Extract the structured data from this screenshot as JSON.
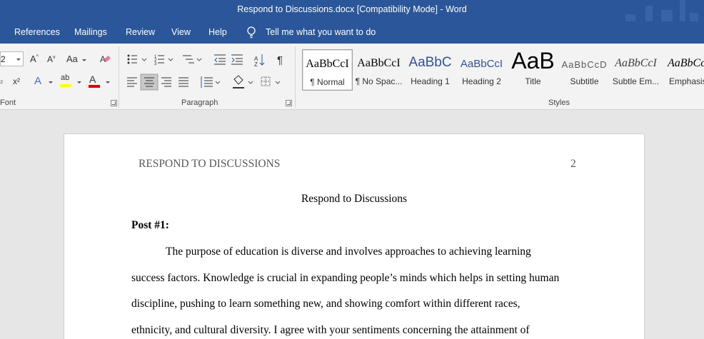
{
  "window": {
    "title": "Respond to Discussions.docx [Compatibility Mode]  -  Word"
  },
  "tabs": [
    {
      "label": "References"
    },
    {
      "label": "Mailings"
    },
    {
      "label": "Review"
    },
    {
      "label": "View"
    },
    {
      "label": "Help"
    }
  ],
  "tell_me": {
    "label": "Tell me what you want to do",
    "icon": "lightbulb-icon"
  },
  "ribbon": {
    "font_group": {
      "label": "Font",
      "font_size": "2",
      "icons": [
        "grow-font-icon",
        "shrink-font-icon",
        "change-case-icon",
        "clear-formatting-icon",
        "subscript-icon",
        "superscript-icon",
        "text-effects-icon",
        "highlight-icon",
        "font-color-icon"
      ],
      "highlight_color": "#ffff00",
      "font_color": "#e00000"
    },
    "paragraph_group": {
      "label": "Paragraph",
      "icons": [
        "bullets-icon",
        "numbering-icon",
        "multilevel-list-icon",
        "decrease-indent-icon",
        "increase-indent-icon",
        "sort-icon",
        "show-marks-icon",
        "align-left-icon",
        "align-center-icon",
        "align-right-icon",
        "justify-icon",
        "line-spacing-icon",
        "shading-icon",
        "borders-icon"
      ],
      "active_alignment": "center"
    },
    "styles_group": {
      "label": "Styles",
      "items": [
        {
          "preview": "AaBbCcI",
          "name": "¶ Normal",
          "selected": true
        },
        {
          "preview": "AaBbCcI",
          "name": "¶ No Spac..."
        },
        {
          "preview": "AaBbC",
          "name": "Heading 1"
        },
        {
          "preview": "AaBbCcI",
          "name": "Heading 2"
        },
        {
          "preview": "AaB",
          "name": "Title"
        },
        {
          "preview": "AaBbCcD",
          "name": "Subtitle"
        },
        {
          "preview": "AaBbCcI",
          "name": "Subtle Em..."
        },
        {
          "preview": "AaBbCc",
          "name": "Emphasis"
        }
      ]
    }
  },
  "document": {
    "header_text": "RESPOND TO DISCUSSIONS",
    "page_number": "2",
    "title": "Respond to Discussions",
    "post_heading": "Post #1:",
    "lines": [
      "The purpose of education is diverse and involves approaches to achieving learning",
      "success factors. Knowledge is crucial in expanding people’s minds which helps in setting human",
      "discipline, pushing to learn something new, and showing comfort within different races,",
      "ethnicity, and cultural diversity. I agree with your sentiments concerning the attainment of"
    ]
  },
  "colors": {
    "titlebar": "#2b579a",
    "ribbon": "#f3f3f3",
    "canvas": "#e6e6e6"
  }
}
